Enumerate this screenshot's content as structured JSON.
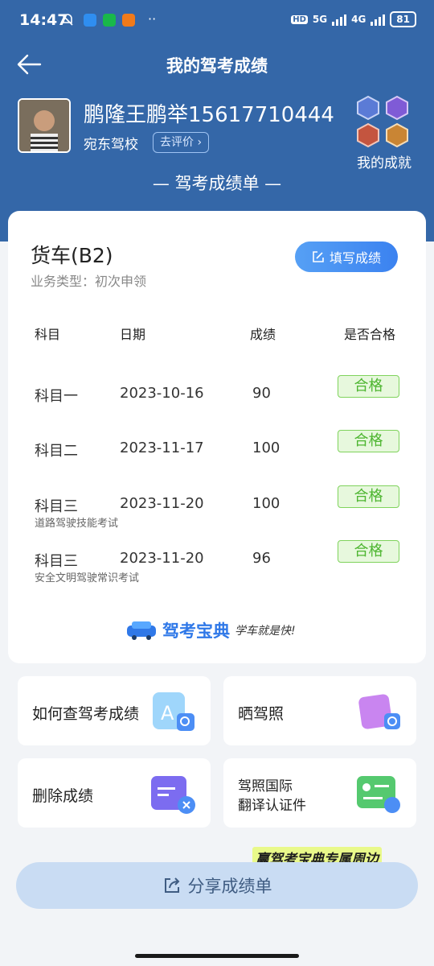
{
  "status_bar": {
    "time": "14:47",
    "hd": "HD",
    "net1": "5G",
    "net2": "4G",
    "battery": "81"
  },
  "header": {
    "title": "我的驾考成绩"
  },
  "profile": {
    "name": "鹏隆王鹏举15617710444",
    "school": "宛东驾校",
    "rate_label": "去评价",
    "achievement_label": "我的成就"
  },
  "sheet_title": "— 驾考成绩单 —",
  "card": {
    "vehicle": "货车(B2)",
    "business_type": "业务类型：初次申领",
    "fill_label": "填写成绩",
    "columns": [
      "科目",
      "日期",
      "成绩",
      "是否合格"
    ],
    "rows": [
      {
        "subject": "科目一",
        "date": "2023-10-16",
        "score": "90",
        "result": "合格",
        "note": ""
      },
      {
        "subject": "科目二",
        "date": "2023-11-17",
        "score": "100",
        "result": "合格",
        "note": ""
      },
      {
        "subject": "科目三",
        "date": "2023-11-20",
        "score": "100",
        "result": "合格",
        "note": "道路驾驶技能考试"
      },
      {
        "subject": "科目三",
        "date": "2023-11-20",
        "score": "96",
        "result": "合格",
        "note": "安全文明驾驶常识考试"
      }
    ],
    "brand_name": "驾考宝典",
    "brand_slogan": "学车就是快!"
  },
  "tiles": [
    {
      "label": "如何查驾考成绩",
      "icon": "search-doc-icon"
    },
    {
      "label": "晒驾照",
      "icon": "photo-icon"
    },
    {
      "label": "删除成绩",
      "icon": "delete-doc-icon"
    },
    {
      "label_line1": "驾照国际",
      "label_line2": "翻译认证件",
      "icon": "id-card-icon"
    }
  ],
  "promo": "赢驾考宝典专属周边",
  "share_label": "分享成绩单",
  "colors": {
    "header_bg": "#3467a8",
    "pass_green": "#4cb52f",
    "accent_blue": "#3b82f0"
  }
}
